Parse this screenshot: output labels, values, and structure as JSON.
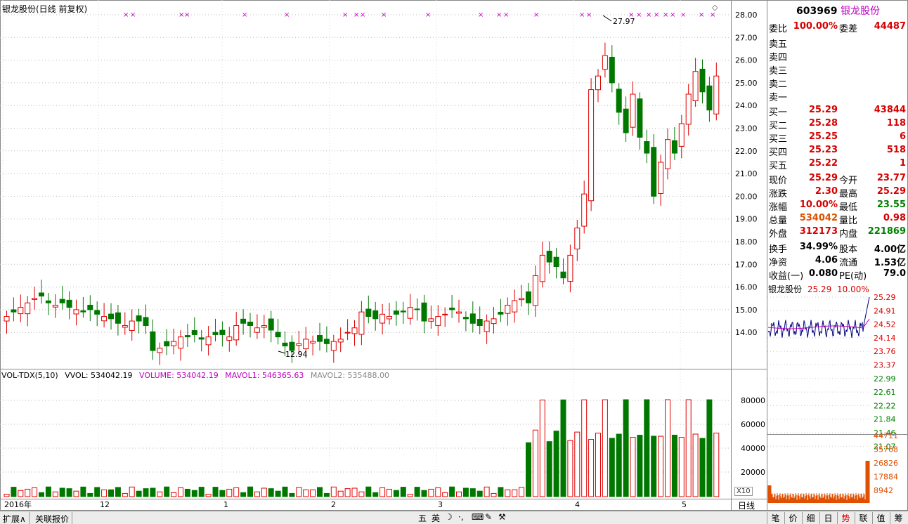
{
  "chart_title": "银龙股份(日线 前复权)",
  "price_axis": [
    "28.00",
    "27.00",
    "26.00",
    "25.00",
    "24.00",
    "23.00",
    "22.00",
    "21.00",
    "20.00",
    "19.00",
    "18.00",
    "17.00",
    "16.00",
    "15.00",
    "14.00"
  ],
  "high_label": "27.97",
  "low_label": "12.94",
  "vol_legend": {
    "name": "VOL-TDX(5,10)",
    "vvol": "VVOL: 534042.19",
    "volume": "VOLUME: 534042.19",
    "mavol1": "MAVOL1: 546365.63",
    "mavol2": "MAVOL2: 535488.00"
  },
  "vol_axis": [
    "80000",
    "60000",
    "40000",
    "20000"
  ],
  "vol_unit": "X10",
  "date_labels": [
    "2016年",
    "12",
    "1",
    "2",
    "3",
    "4",
    "5"
  ],
  "period_label": "日线",
  "stock": {
    "code": "603969",
    "name": "银龙股份"
  },
  "weibi": {
    "l1": "委比",
    "v1": "100.00%",
    "l2": "委差",
    "v2": "44487"
  },
  "sell_levels": [
    "卖五",
    "卖四",
    "卖三",
    "卖二",
    "卖一"
  ],
  "buy_levels": [
    {
      "label": "买一",
      "price": "25.29",
      "vol": "43844"
    },
    {
      "label": "买二",
      "price": "25.28",
      "vol": "118"
    },
    {
      "label": "买三",
      "price": "25.25",
      "vol": "6"
    },
    {
      "label": "买四",
      "price": "25.23",
      "vol": "518"
    },
    {
      "label": "买五",
      "price": "25.22",
      "vol": "1"
    }
  ],
  "quote": [
    {
      "l1": "现价",
      "v1": "25.29",
      "l2": "今开",
      "v2": "23.77"
    },
    {
      "l1": "涨跌",
      "v1": "2.30",
      "l2": "最高",
      "v2": "25.29"
    },
    {
      "l1": "涨幅",
      "v1": "10.00%",
      "l2": "最低",
      "v2": "23.55"
    },
    {
      "l1": "总量",
      "v1": "534042",
      "l2": "量比",
      "v2": "0.98"
    },
    {
      "l1": "外盘",
      "v1": "312173",
      "l2": "内盘",
      "v2": "221869"
    }
  ],
  "fundamentals": [
    {
      "l1": "换手",
      "v1": "34.99%",
      "l2": "股本",
      "v2": "4.00亿"
    },
    {
      "l1": "净资",
      "v1": "4.06",
      "l2": "流通",
      "v2": "1.53亿"
    },
    {
      "l1": "收益(一)",
      "v1": "0.080",
      "l2": "PE(动)",
      "v2": "79.0"
    }
  ],
  "mini": {
    "name": "银龙股份",
    "price": "25.29",
    "pct": "10.00%"
  },
  "mini_price_axis": [
    "25.29",
    "24.91",
    "24.52",
    "24.14",
    "23.76",
    "23.37",
    "22.99",
    "22.61",
    "22.22",
    "21.84",
    "21.46",
    "21.07"
  ],
  "mini_vol_axis": [
    "44711",
    "35768",
    "26826",
    "17884",
    "8942"
  ],
  "status_buttons": [
    "扩展∧",
    "关联报价"
  ],
  "ime": [
    "五",
    "英",
    "☽",
    "·,",
    "⌨",
    "✎",
    "⚒"
  ],
  "right_tabs": [
    "笔",
    "价",
    "细",
    "日",
    "势",
    "联",
    "值",
    "筹"
  ],
  "active_tab": "势"
}
